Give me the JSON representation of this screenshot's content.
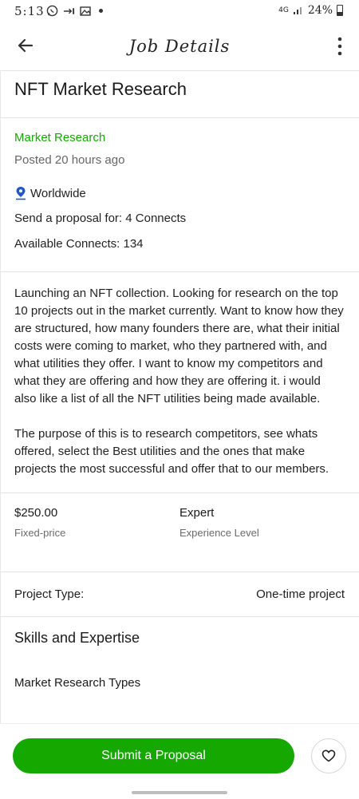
{
  "status_bar": {
    "time": "5:13",
    "network": "4G",
    "battery": "24%",
    "icons": [
      "whatsapp-icon",
      "missed-call-icon",
      "gallery-icon",
      "notification-dot-icon",
      "signal-icon",
      "battery-icon"
    ]
  },
  "app_bar": {
    "title": "Job Details",
    "back_icon": "arrow-left-icon",
    "menu_icon": "more-vertical-icon"
  },
  "job": {
    "title": "NFT Market Research",
    "category": "Market Research",
    "posted": "Posted 20 hours ago",
    "location": "Worldwide",
    "proposal_cost": "Send a proposal for: 4 Connects",
    "available_connects": "Available Connects: 134",
    "description_p1": "Launching an NFT collection. Looking for research on the top 10 projects out in the market currently. Want to know how they are structured, how many founders there are, what their initial costs were coming to market, who they partnered with, and what utilities they offer. I want to know my competitors and what they are offering and how they are offering it. i would also like a list of all the NFT utilities being made available.",
    "description_p2": "The purpose of this is to research competitors, see whats offered, select the Best utilities and the ones that make projects the most successful and offer that to our members.",
    "price": "$250.00",
    "price_type": "Fixed-price",
    "experience": "Expert",
    "experience_label": "Experience Level",
    "project_type_label": "Project Type:",
    "project_type_value": "One-time project",
    "skills_title": "Skills and Expertise",
    "skills_subtitle": "Market Research Types"
  },
  "actions": {
    "submit_label": "Submit a Proposal",
    "save_icon": "heart-icon"
  },
  "colors": {
    "accent": "#14a800",
    "location_icon": "#1f57c3"
  }
}
